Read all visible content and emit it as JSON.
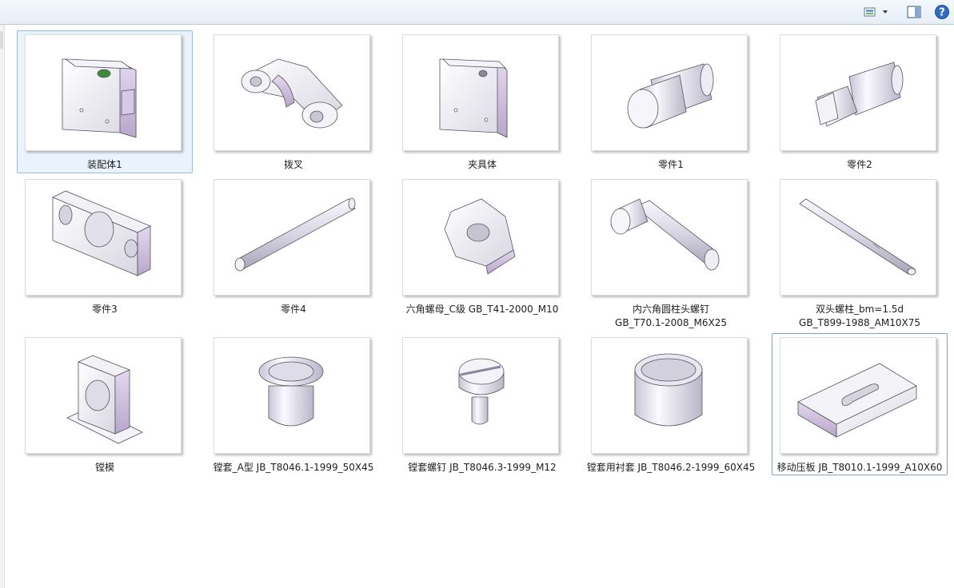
{
  "toolbar": {
    "view_icon": "view-options-icon",
    "view_arrow_icon": "chevron-down-icon",
    "preview_pane_icon": "preview-pane-icon",
    "help_icon": "help-icon",
    "help_glyph": "?"
  },
  "files": [
    {
      "name": "装配体1",
      "icon": "assembly-thumbnail",
      "selected": true
    },
    {
      "name": "拨叉",
      "icon": "fork-part-thumbnail"
    },
    {
      "name": "夹具体",
      "icon": "fixture-body-thumbnail"
    },
    {
      "name": "零件1",
      "icon": "shaft-part-thumbnail"
    },
    {
      "name": "零件2",
      "icon": "shaft-flat-part-thumbnail"
    },
    {
      "name": "零件3",
      "icon": "plate-part-thumbnail"
    },
    {
      "name": "零件4",
      "icon": "pin-part-thumbnail"
    },
    {
      "name": "六角螺母_C级 GB_T41-2000_M10",
      "icon": "hex-nut-thumbnail"
    },
    {
      "name": "内六角圆柱头螺钉",
      "name2": "GB_T70.1-2008_M6X25",
      "icon": "socket-screw-thumbnail"
    },
    {
      "name": "双头螺柱_bm=1.5d",
      "name2": "GB_T899-1988_AM10X75",
      "icon": "stud-thumbnail"
    },
    {
      "name": "镗模",
      "icon": "boring-jig-thumbnail"
    },
    {
      "name": "镗套_A型 JB_T8046.1-1999_50X45",
      "icon": "bushing-thumbnail"
    },
    {
      "name": "镗套螺钉 JB_T8046.3-1999_M12",
      "icon": "bushing-screw-thumbnail"
    },
    {
      "name": "镗套用衬套 JB_T8046.2-1999_60X45",
      "icon": "liner-thumbnail"
    },
    {
      "name": "移动压板 JB_T8010.1-1999_A10X60",
      "icon": "clamp-plate-thumbnail",
      "focused": true
    }
  ]
}
